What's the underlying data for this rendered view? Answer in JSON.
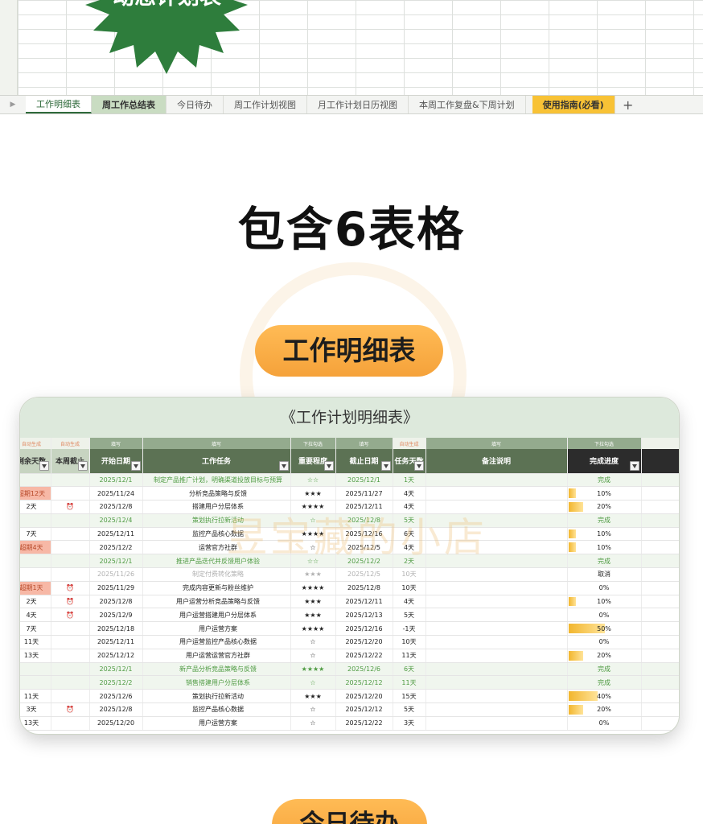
{
  "badge": {
    "title": "动态计划表"
  },
  "tabs": [
    {
      "label": "工作明细表",
      "style": "active"
    },
    {
      "label": "周工作总结表",
      "style": "green"
    },
    {
      "label": "今日待办",
      "style": "plain"
    },
    {
      "label": "周工作计划视图",
      "style": "plain"
    },
    {
      "label": "月工作计划日历视图",
      "style": "plain"
    },
    {
      "label": "本周工作复盘&下周计划",
      "style": "plain"
    },
    {
      "label": "使用指南(必看)",
      "style": "yellow"
    }
  ],
  "tab_nav_icon": "▶",
  "tab_add_icon": "+",
  "headline": "包含6表格",
  "section_pill": "工作明细表",
  "next_pill": "今日待办",
  "watermark": "昱宝藏的小店",
  "sheet": {
    "title": "《工作计划明细表》",
    "hints": [
      "自动生成",
      "自动生成",
      "填写",
      "填写",
      "下拉勾选",
      "填写",
      "自动生成",
      "填写",
      "下拉勾选"
    ],
    "headers": [
      "剩余天数",
      "本周截止",
      "开始日期",
      "工作任务",
      "重要程度",
      "截止日期",
      "任务天数",
      "备注说明",
      "完成进度"
    ],
    "rows": [
      {
        "remain": "",
        "week": "",
        "start": "2025/12/1",
        "task": "制定产品推广计划，明确渠道投放目标与预算",
        "level": "☆☆",
        "end": "2025/12/1",
        "days": "1天",
        "note": "",
        "status": "完成",
        "progress": 0,
        "kind": "done"
      },
      {
        "remain": "超期12天",
        "week": "",
        "start": "2025/11/24",
        "task": "分析竞品策略与反馈",
        "level": "★★★",
        "end": "2025/11/27",
        "days": "4天",
        "note": "",
        "status": "10%",
        "progress": 0.1,
        "kind": "normal",
        "overdue": true
      },
      {
        "remain": "2天",
        "week": "⏰",
        "start": "2025/12/8",
        "task": "搭建用户分层体系",
        "level": "★★★★",
        "end": "2025/12/11",
        "days": "4天",
        "note": "",
        "status": "20%",
        "progress": 0.2,
        "kind": "normal"
      },
      {
        "remain": "",
        "week": "",
        "start": "2025/12/4",
        "task": "策划执行拉新活动",
        "level": "☆",
        "end": "2025/12/8",
        "days": "5天",
        "note": "",
        "status": "完成",
        "progress": 0,
        "kind": "done"
      },
      {
        "remain": "7天",
        "week": "",
        "start": "2025/12/11",
        "task": "监控产品核心数据",
        "level": "★★★★",
        "end": "2025/12/16",
        "days": "6天",
        "note": "",
        "status": "10%",
        "progress": 0.1,
        "kind": "normal"
      },
      {
        "remain": "超期4天",
        "week": "",
        "start": "2025/12/2",
        "task": "运营官方社群",
        "level": "☆",
        "end": "2025/12/5",
        "days": "4天",
        "note": "",
        "status": "10%",
        "progress": 0.1,
        "kind": "normal",
        "overdue": true
      },
      {
        "remain": "",
        "week": "",
        "start": "2025/12/1",
        "task": "推进产品迭代并反馈用户体验",
        "level": "☆☆",
        "end": "2025/12/2",
        "days": "2天",
        "note": "",
        "status": "完成",
        "progress": 0,
        "kind": "done"
      },
      {
        "remain": "",
        "week": "",
        "start": "2025/11/26",
        "task": "制定付费转化策略",
        "level": "★★★",
        "end": "2025/12/5",
        "days": "10天",
        "note": "",
        "status": "取消",
        "progress": 0,
        "kind": "cancel"
      },
      {
        "remain": "超期1天",
        "week": "⏰",
        "start": "2025/11/29",
        "task": "完成内容更新与粉丝维护",
        "level": "★★★★",
        "end": "2025/12/8",
        "days": "10天",
        "note": "",
        "status": "0%",
        "progress": 0,
        "kind": "normal",
        "overdue": true
      },
      {
        "remain": "2天",
        "week": "⏰",
        "start": "2025/12/8",
        "task": "用户运营分析竞品策略与反馈",
        "level": "★★★",
        "end": "2025/12/11",
        "days": "4天",
        "note": "",
        "status": "10%",
        "progress": 0.1,
        "kind": "normal"
      },
      {
        "remain": "4天",
        "week": "⏰",
        "start": "2025/12/9",
        "task": "用户运营搭建用户分层体系",
        "level": "★★★",
        "end": "2025/12/13",
        "days": "5天",
        "note": "",
        "status": "0%",
        "progress": 0,
        "kind": "normal"
      },
      {
        "remain": "7天",
        "week": "",
        "start": "2025/12/18",
        "task": "用户运营方案",
        "level": "★★★★",
        "end": "2025/12/16",
        "days": "-1天",
        "note": "",
        "status": "50%",
        "progress": 0.5,
        "kind": "normal"
      },
      {
        "remain": "11天",
        "week": "",
        "start": "2025/12/11",
        "task": "用户运营监控产品核心数据",
        "level": "☆",
        "end": "2025/12/20",
        "days": "10天",
        "note": "",
        "status": "0%",
        "progress": 0,
        "kind": "normal"
      },
      {
        "remain": "13天",
        "week": "",
        "start": "2025/12/12",
        "task": "用户运营运营官方社群",
        "level": "☆",
        "end": "2025/12/22",
        "days": "11天",
        "note": "",
        "status": "20%",
        "progress": 0.2,
        "kind": "normal"
      },
      {
        "remain": "",
        "week": "",
        "start": "2025/12/1",
        "task": "新产品分析竞品策略与反馈",
        "level": "★★★★",
        "end": "2025/12/6",
        "days": "6天",
        "note": "",
        "status": "完成",
        "progress": 0,
        "kind": "done"
      },
      {
        "remain": "",
        "week": "",
        "start": "2025/12/2",
        "task": "销售搭建用户分层体系",
        "level": "☆",
        "end": "2025/12/12",
        "days": "11天",
        "note": "",
        "status": "完成",
        "progress": 0,
        "kind": "done"
      },
      {
        "remain": "11天",
        "week": "",
        "start": "2025/12/6",
        "task": "策划执行拉新活动",
        "level": "★★★",
        "end": "2025/12/20",
        "days": "15天",
        "note": "",
        "status": "40%",
        "progress": 0.4,
        "kind": "normal"
      },
      {
        "remain": "3天",
        "week": "⏰",
        "start": "2025/12/8",
        "task": "监控产品核心数据",
        "level": "☆",
        "end": "2025/12/12",
        "days": "5天",
        "note": "",
        "status": "20%",
        "progress": 0.2,
        "kind": "normal"
      },
      {
        "remain": "13天",
        "week": "",
        "start": "2025/12/20",
        "task": "用户运营方案",
        "level": "☆",
        "end": "2025/12/22",
        "days": "3天",
        "note": "",
        "status": "0%",
        "progress": 0,
        "kind": "normal"
      }
    ]
  },
  "colors": {
    "header_green": "#5c7254",
    "done_green": "#4f9b43",
    "overdue_bg": "#f7b8a6",
    "pill_orange": "#f5a23a",
    "badge_green": "#2e7d3c"
  }
}
